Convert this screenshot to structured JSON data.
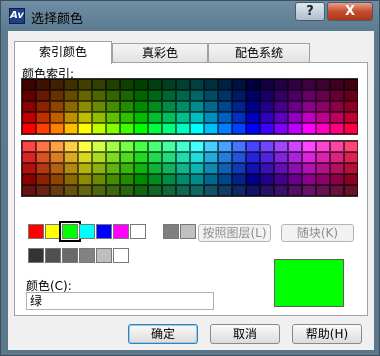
{
  "window": {
    "title": "选择颜色",
    "app_icon_glyph": "Av",
    "help_label": "?",
    "close_label": "X"
  },
  "tabs": [
    {
      "label": "索引颜色",
      "active": true
    },
    {
      "label": "真彩色",
      "active": false
    },
    {
      "label": "配色系统",
      "active": false
    }
  ],
  "panel": {
    "index_label": "颜色索引:",
    "bylayer_label": "按照图层(L)",
    "byblock_label": "随块(K)",
    "color_label": "颜色(C):",
    "color_value": "绿"
  },
  "palette": {
    "hues": [
      "#ff0000",
      "#ff4000",
      "#ff7f00",
      "#ffbf00",
      "#ffff00",
      "#bfff00",
      "#7fff00",
      "#40ff00",
      "#00ff00",
      "#00ff40",
      "#00ff7f",
      "#00ffbf",
      "#00ffff",
      "#00bfff",
      "#007fff",
      "#0040ff",
      "#0000ff",
      "#4000ff",
      "#7f00ff",
      "#bf00ff",
      "#ff00ff",
      "#ff00bf",
      "#ff007f",
      "#ff0040"
    ],
    "upper_shades": [
      0.25,
      0.4,
      0.55,
      0.75,
      1.0
    ],
    "lower_tints": [
      0.55,
      0.72,
      0.85,
      1.0,
      0.7
    ]
  },
  "standard_colors": [
    {
      "name": "red",
      "color": "#ff0000"
    },
    {
      "name": "yellow",
      "color": "#ffff00"
    },
    {
      "name": "green",
      "color": "#00ff00",
      "selected": true
    },
    {
      "name": "cyan",
      "color": "#00ffff"
    },
    {
      "name": "blue",
      "color": "#0000ff"
    },
    {
      "name": "magenta",
      "color": "#ff00ff"
    },
    {
      "name": "white",
      "color": "#ffffff"
    },
    {
      "name": "gray-8",
      "color": "#808080"
    },
    {
      "name": "gray-9",
      "color": "#c0c0c0"
    }
  ],
  "gray_colors": [
    "#333333",
    "#505050",
    "#696969",
    "#828282",
    "#bebebe",
    "#ffffff"
  ],
  "preview_color": "#00ff00",
  "buttons": {
    "ok": "确定",
    "cancel": "取消",
    "help": "帮助(H)"
  }
}
